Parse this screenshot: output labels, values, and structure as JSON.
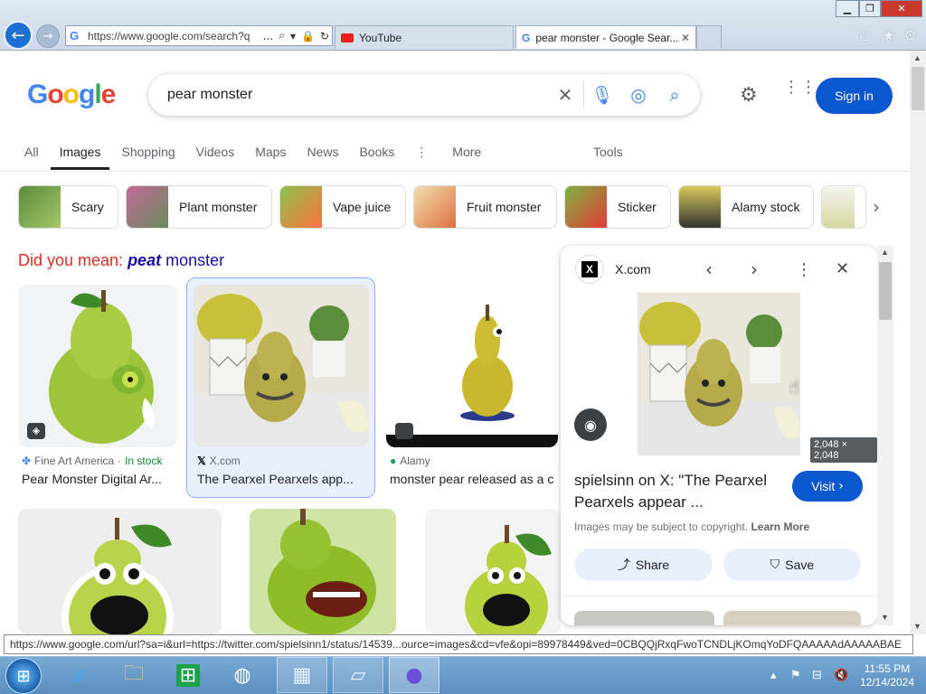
{
  "browser": {
    "address": "https://www.google.com/search?q",
    "address_ellipsis": "...",
    "tabs": [
      {
        "label": "YouTube"
      },
      {
        "label": "pear monster - Google Sear..."
      }
    ]
  },
  "google": {
    "logo_letters": [
      "G",
      "o",
      "o",
      "g",
      "l",
      "e"
    ],
    "query": "pear monster",
    "signin": "Sign in",
    "nav_tabs": [
      "All",
      "Images",
      "Shopping",
      "Videos",
      "Maps",
      "News",
      "Books",
      "More"
    ],
    "active_tab": "Images",
    "tools": "Tools",
    "chips": [
      "Scary",
      "Plant monster",
      "Vape juice",
      "Fruit monster",
      "Sticker",
      "Alamy stock"
    ],
    "did_you_mean": {
      "prefix": "Did you mean: ",
      "bold": "peat",
      "rest": " monster"
    }
  },
  "results": [
    {
      "source": "Fine Art America",
      "stock": "In stock",
      "title": "Pear Monster Digital Ar..."
    },
    {
      "source": "X.com",
      "title": "The Pearxel Pearxels app..."
    },
    {
      "source": "Alamy",
      "title": "monster pear released as a c"
    }
  ],
  "panel": {
    "source": "X.com",
    "dimensions": "2,048 × 2,048",
    "title": "spielsinn on X: \"The Pearxel Pearxels appear ...",
    "visit": "Visit",
    "copyright": "Images may be subject to copyright.",
    "learn_more": "Learn More",
    "share": "Share",
    "save": "Save"
  },
  "status_bar": "https://www.google.com/url?sa=i&url=https://twitter.com/spielsinn1/status/14539...ource=images&cd=vfe&opi=89978449&ved=0CBQQjRxqFwoTCNDLjKOmqYoDFQAAAAAdAAAAABAE",
  "taskbar": {
    "time": "11:55 PM",
    "date": "12/14/2024"
  },
  "colors": {
    "accent": "#0b57d0",
    "did_you_mean_red": "#d93025",
    "link_blue": "#1a0dab"
  }
}
